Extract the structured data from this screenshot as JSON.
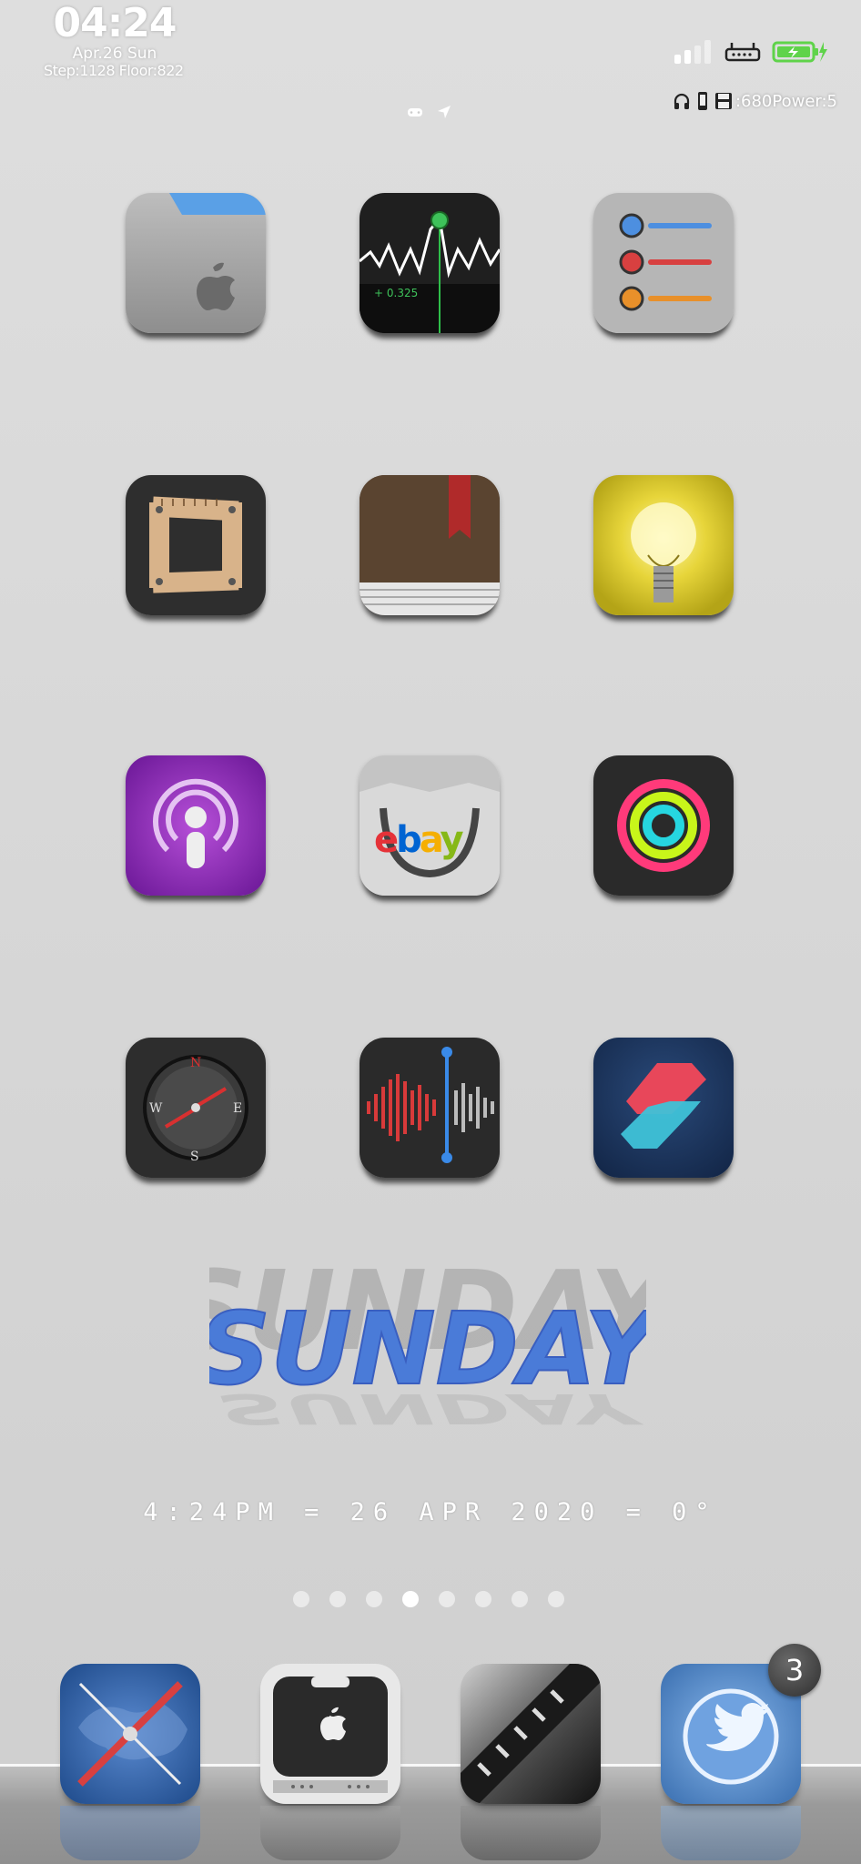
{
  "status_bar": {
    "time": "04:24",
    "date": "Apr.26 Sun",
    "steps": "Step:1128 Floor:822",
    "power_info": ":680Power:5"
  },
  "apps": [
    {
      "name": "files-app",
      "icon": "folder-apple-icon"
    },
    {
      "name": "stocks-app",
      "icon": "stocks-chart-icon",
      "label_text": "+ 0.325"
    },
    {
      "name": "reminders-app",
      "icon": "reminders-list-icon"
    },
    {
      "name": "measure-app",
      "icon": "ruler-frame-icon"
    },
    {
      "name": "books-app",
      "icon": "book-icon"
    },
    {
      "name": "tips-app",
      "icon": "lightbulb-icon"
    },
    {
      "name": "podcasts-app",
      "icon": "podcast-icon"
    },
    {
      "name": "ebay-app",
      "icon": "ebay-bag-icon",
      "brand": "ebay"
    },
    {
      "name": "fitness-app",
      "icon": "activity-rings-icon"
    },
    {
      "name": "compass-app",
      "icon": "compass-icon",
      "letters": [
        "N",
        "S",
        "W",
        "E"
      ]
    },
    {
      "name": "voice-memos-app",
      "icon": "waveform-icon"
    },
    {
      "name": "shortcuts-app",
      "icon": "shortcuts-icon"
    }
  ],
  "widget": {
    "day": "SUNDAY",
    "datebar": "4:24PM = 26 APR 2020 = 0°"
  },
  "page_dots": {
    "count": 8,
    "active_index": 3
  },
  "dock": {
    "apps": [
      {
        "name": "safari-app",
        "icon": "safari-compass-icon"
      },
      {
        "name": "finder-app",
        "icon": "apple-device-icon"
      },
      {
        "name": "zip-app",
        "icon": "zipper-icon"
      },
      {
        "name": "twitter-app",
        "icon": "twitter-bird-icon"
      }
    ],
    "badge": "3"
  },
  "colors": {
    "background": "#d8d8d8",
    "sunday_blue": "#4a7bd8",
    "battery_green": "#5fd34a"
  }
}
